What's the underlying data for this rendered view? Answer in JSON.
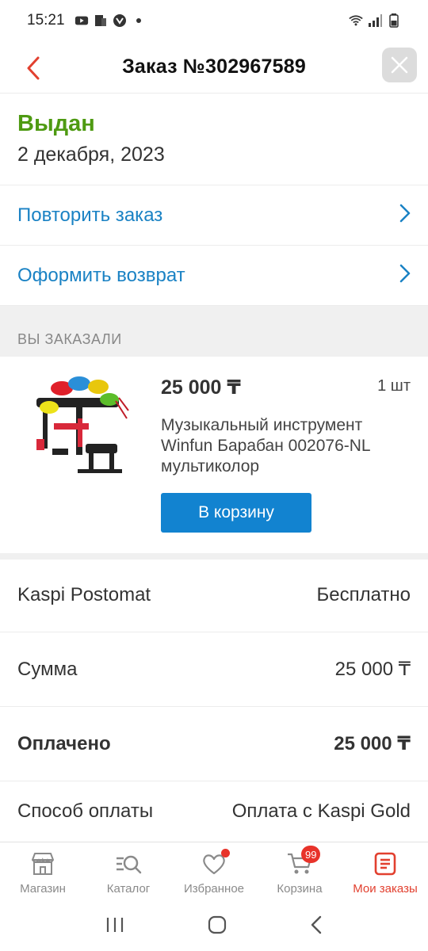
{
  "status_bar": {
    "time": "15:21"
  },
  "header": {
    "title": "Заказ №302967589"
  },
  "order": {
    "status": "Выдан",
    "date": "2 декабря, 2023"
  },
  "actions": [
    {
      "label": "Повторить заказ"
    },
    {
      "label": "Оформить возврат"
    }
  ],
  "section": {
    "title": "ВЫ ЗАКАЗАЛИ"
  },
  "item": {
    "price": "25 000 ₸",
    "qty": "1 шт",
    "name": "Музыкальный инструмент Winfun Барабан 002076-NL мультиколор",
    "cart_label": "В корзину"
  },
  "summary": [
    {
      "label": "Kaspi Postomat",
      "value": "Бесплатно"
    },
    {
      "label": "Сумма",
      "value": "25 000 ₸"
    },
    {
      "label": "Оплачено",
      "value": "25 000 ₸"
    },
    {
      "label": "Способ оплаты",
      "value": "Оплата с Kaspi Gold"
    }
  ],
  "bottom_nav": [
    {
      "label": "Магазин",
      "icon": "shop-icon"
    },
    {
      "label": "Каталог",
      "icon": "catalog-search-icon"
    },
    {
      "label": "Избранное",
      "icon": "heart-icon"
    },
    {
      "label": "Корзина",
      "icon": "cart-icon",
      "badge": "99"
    },
    {
      "label": "Мои заказы",
      "icon": "orders-icon"
    }
  ],
  "colors": {
    "accent_red": "#e2402f",
    "status_green": "#4e9a12",
    "link_blue": "#1a82c4",
    "button_blue": "#1283d0"
  }
}
